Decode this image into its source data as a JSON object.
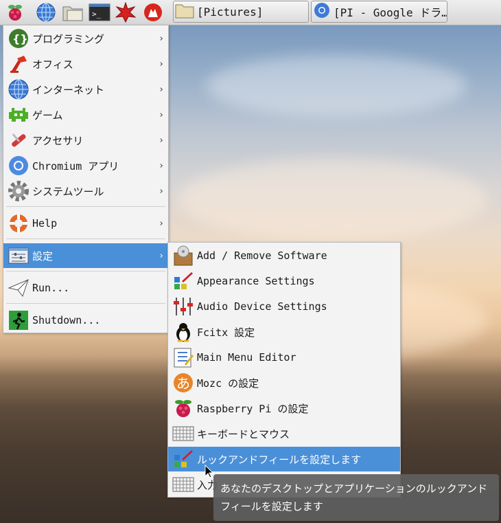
{
  "taskbar": {
    "tasks": [
      {
        "label": "[Pictures]",
        "icon": "folder-icon"
      },
      {
        "label": "[PI - Google ドラ…",
        "icon": "chromium-icon"
      }
    ]
  },
  "main_menu": {
    "items": [
      {
        "label": "プログラミング",
        "icon": "programming-icon",
        "submenu": true
      },
      {
        "label": "オフィス",
        "icon": "office-icon",
        "submenu": true
      },
      {
        "label": "インターネット",
        "icon": "globe-icon",
        "submenu": true
      },
      {
        "label": "ゲーム",
        "icon": "games-icon",
        "submenu": true
      },
      {
        "label": "アクセサリ",
        "icon": "accessories-icon",
        "submenu": true
      },
      {
        "label": "Chromium アプリ",
        "icon": "chromium-icon",
        "submenu": true
      },
      {
        "label": "システムツール",
        "icon": "gear-icon",
        "submenu": true
      },
      {
        "label": "Help",
        "icon": "lifebuoy-icon",
        "submenu": true
      },
      {
        "label": "設定",
        "icon": "preferences-icon",
        "submenu": true,
        "selected": true
      },
      {
        "label": "Run...",
        "icon": "paper-plane-icon",
        "submenu": false
      },
      {
        "label": "Shutdown...",
        "icon": "exit-icon",
        "submenu": false
      }
    ]
  },
  "settings_menu": {
    "items": [
      {
        "label": "Add / Remove Software",
        "icon": "package-icon"
      },
      {
        "label": "Appearance Settings",
        "icon": "appearance-icon"
      },
      {
        "label": "Audio Device Settings",
        "icon": "mixer-icon"
      },
      {
        "label": "Fcitx 設定",
        "icon": "penguin-icon"
      },
      {
        "label": "Main Menu Editor",
        "icon": "menu-editor-icon"
      },
      {
        "label": "Mozc の設定",
        "icon": "mozc-icon"
      },
      {
        "label": "Raspberry Pi の設定",
        "icon": "raspberry-icon"
      },
      {
        "label": "キーボードとマウス",
        "icon": "keyboard-icon"
      },
      {
        "label": "ルックアンドフィールを設定します",
        "icon": "appearance-icon",
        "selected": true
      },
      {
        "label": "入力",
        "icon": "keyboard-icon"
      }
    ]
  },
  "tooltip": {
    "text": "あなたのデスクトップとアプリケーションのルックアンドフィールを設定します"
  }
}
